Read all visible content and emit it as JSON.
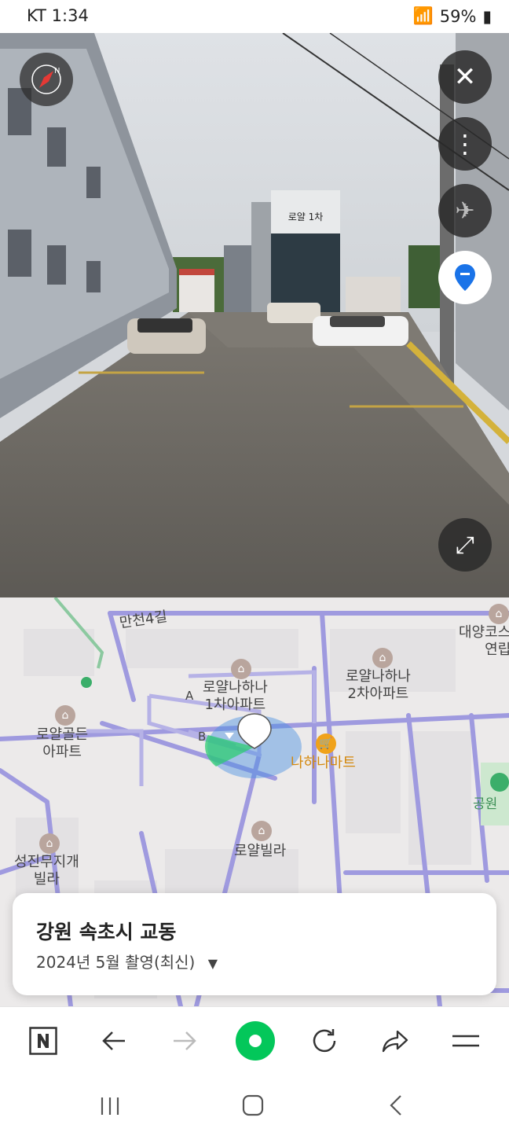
{
  "status": {
    "carrier_time": "KT 1:34",
    "battery": "59%"
  },
  "street_view": {
    "building_sign": "로얄 1차",
    "close_icon": "close-icon",
    "more_icon": "more-vertical-icon",
    "plane_icon": "airplane-icon",
    "location_icon": "map-pin-icon",
    "expand_icon": "expand-icon",
    "compass_icon": "compass-icon"
  },
  "map": {
    "streets": [
      "만천4길"
    ],
    "labels": [
      {
        "key": "royal_hana_1",
        "text": "로얄나하나\n1차아파트"
      },
      {
        "key": "royal_hana_2",
        "text": "로얄나하나\n2차아파트"
      },
      {
        "key": "royal_golden",
        "text": "로얄골든\n아파트"
      },
      {
        "key": "nahana_mart",
        "text": "나하나마트"
      },
      {
        "key": "royal_villa",
        "text": "로얄빌라"
      },
      {
        "key": "seongjin",
        "text": "성진무지개\n빌라"
      },
      {
        "key": "daeyang",
        "text": "대양코스\n연립"
      },
      {
        "key": "park",
        "text": "공원"
      }
    ],
    "block_labels": [
      "A",
      "B"
    ]
  },
  "info_card": {
    "title": "강원 속초시 교동",
    "subtitle": "2024년 5월 촬영(최신)"
  },
  "toolbar": {
    "buttons": [
      "naver-icon",
      "back-arrow-icon",
      "forward-arrow-icon",
      "green-dot-icon",
      "reload-icon",
      "share-icon",
      "menu-icon"
    ]
  },
  "colors": {
    "accent_green": "#03c75a",
    "blue": "#1a73e8",
    "map_road": "#9f9adf"
  }
}
